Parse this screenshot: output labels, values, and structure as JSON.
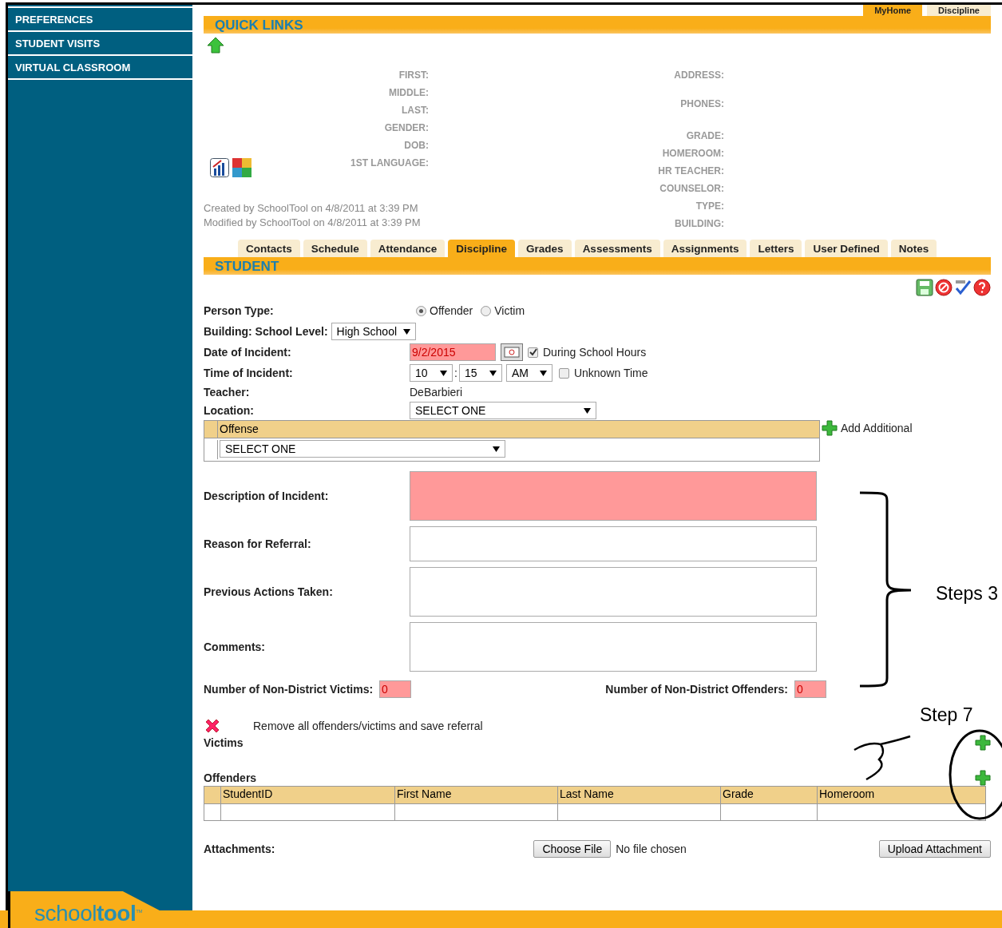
{
  "top_tabs": [
    {
      "label": "MyHome",
      "selected": true
    },
    {
      "label": "Discipline",
      "selected": false
    }
  ],
  "sidebar": {
    "items": [
      "PREFERENCES",
      "STUDENT VISITS",
      "VIRTUAL CLASSROOM"
    ],
    "logo": {
      "light": "school",
      "bold": "tool",
      "mark": "TM"
    }
  },
  "quick_links": {
    "title": "QUICK LINKS",
    "left_fields": [
      "FIRST:",
      "MIDDLE:",
      "LAST:",
      "GENDER:",
      "DOB:",
      "1ST LANGUAGE:"
    ],
    "right_fields": [
      "ADDRESS:",
      "PHONES:",
      "GRADE:",
      "HOMEROOM:",
      "HR TEACHER:",
      "COUNSELOR:",
      "TYPE:",
      "BUILDING:"
    ],
    "created": "Created by SchoolTool on 4/8/2011 at 3:39 PM",
    "modified": "Modified by SchoolTool on 4/8/2011 at 3:39 PM"
  },
  "tabs": [
    {
      "label": "Contacts",
      "selected": false
    },
    {
      "label": "Schedule",
      "selected": false
    },
    {
      "label": "Attendance",
      "selected": false
    },
    {
      "label": "Discipline",
      "selected": true
    },
    {
      "label": "Grades",
      "selected": false
    },
    {
      "label": "Assessments",
      "selected": false
    },
    {
      "label": "Assignments",
      "selected": false
    },
    {
      "label": "Letters",
      "selected": false
    },
    {
      "label": "User Defined",
      "selected": false
    },
    {
      "label": "Notes",
      "selected": false
    }
  ],
  "section_title": "STUDENT",
  "form": {
    "person_type": {
      "label": "Person Type:",
      "options": [
        {
          "label": "Offender",
          "selected": true
        },
        {
          "label": "Victim",
          "selected": false
        }
      ]
    },
    "building": {
      "label": "Building: School Level:",
      "value": "High School"
    },
    "date": {
      "label": "Date of Incident:",
      "value": "9/2/2015",
      "school_hours": {
        "label": "During School Hours",
        "checked": true
      }
    },
    "time": {
      "label": "Time of Incident:",
      "hour": "10",
      "separator": ":",
      "minute": "15",
      "ampm": "AM",
      "unknown": {
        "label": "Unknown Time",
        "checked": false
      }
    },
    "teacher": {
      "label": "Teacher:",
      "value": "DeBarbieri"
    },
    "location": {
      "label": "Location:",
      "value": "SELECT ONE"
    },
    "offense": {
      "header": "Offense",
      "value": "SELECT ONE",
      "add": "Add Additional"
    },
    "text_areas": [
      {
        "label": "Description of Incident:",
        "highlighted": true
      },
      {
        "label": "Reason for Referral:",
        "highlighted": false
      },
      {
        "label": "Previous Actions Taken:",
        "highlighted": false
      },
      {
        "label": "Comments:",
        "highlighted": false
      }
    ],
    "victims_count": {
      "label": "Number of Non-District Victims:",
      "value": "0"
    },
    "offenders_count": {
      "label": "Number of Non-District Offenders:",
      "value": "0"
    },
    "remove": "Remove all offenders/victims and save referral",
    "victims": "Victims",
    "offenders": "Offenders",
    "columns": [
      "StudentID",
      "First Name",
      "Last Name",
      "Grade",
      "Homeroom"
    ],
    "attachments": {
      "label": "Attachments:",
      "choose": "Choose File",
      "status": "No file chosen",
      "upload": "Upload Attachment"
    }
  },
  "annotations": [
    {
      "text": "Steps 3"
    },
    {
      "text": "Step 7"
    }
  ]
}
